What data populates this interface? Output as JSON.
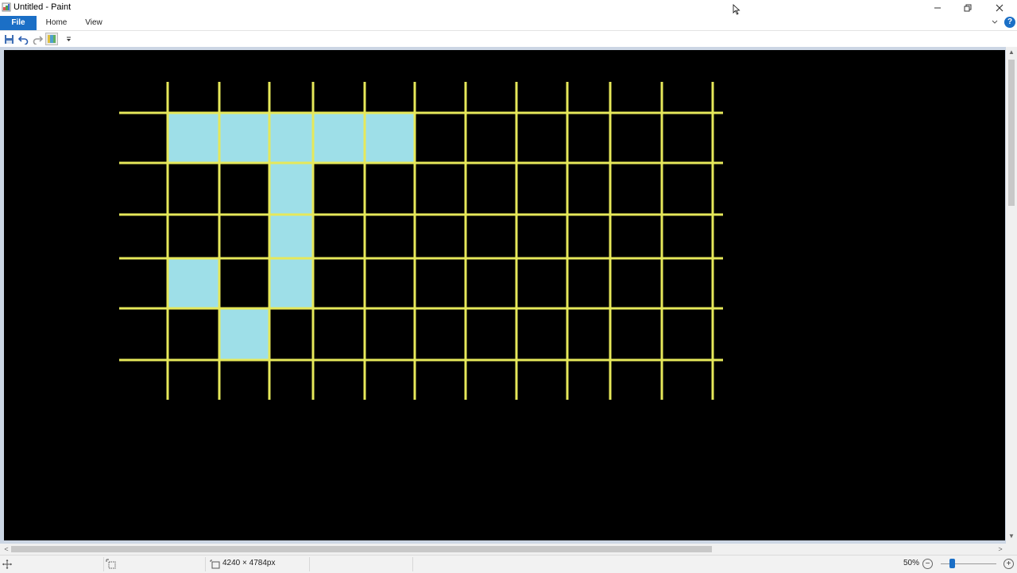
{
  "window": {
    "title": "Untitled - Paint"
  },
  "ribbon": {
    "tabs": [
      "File",
      "Home",
      "View"
    ]
  },
  "quick_access": {
    "icons": [
      "save-icon",
      "undo-icon",
      "redo-icon",
      "paint-icon",
      "customize-icon"
    ]
  },
  "drawing": {
    "background": "#000000",
    "grid_color": "#e6e85a",
    "fill_color": "#9edfe8",
    "columns": 11,
    "rows": 5,
    "filled_cells": [
      [
        0,
        0
      ],
      [
        1,
        0
      ],
      [
        2,
        0
      ],
      [
        3,
        0
      ],
      [
        4,
        0
      ],
      [
        2,
        1
      ],
      [
        2,
        2
      ],
      [
        2,
        3
      ],
      [
        0,
        3
      ],
      [
        1,
        4
      ]
    ]
  },
  "status": {
    "image_size": "4240 × 4784px",
    "zoom_level": "50%",
    "zoom_fraction": 0.2
  },
  "colors": {
    "accent": "#1b6fc6"
  }
}
